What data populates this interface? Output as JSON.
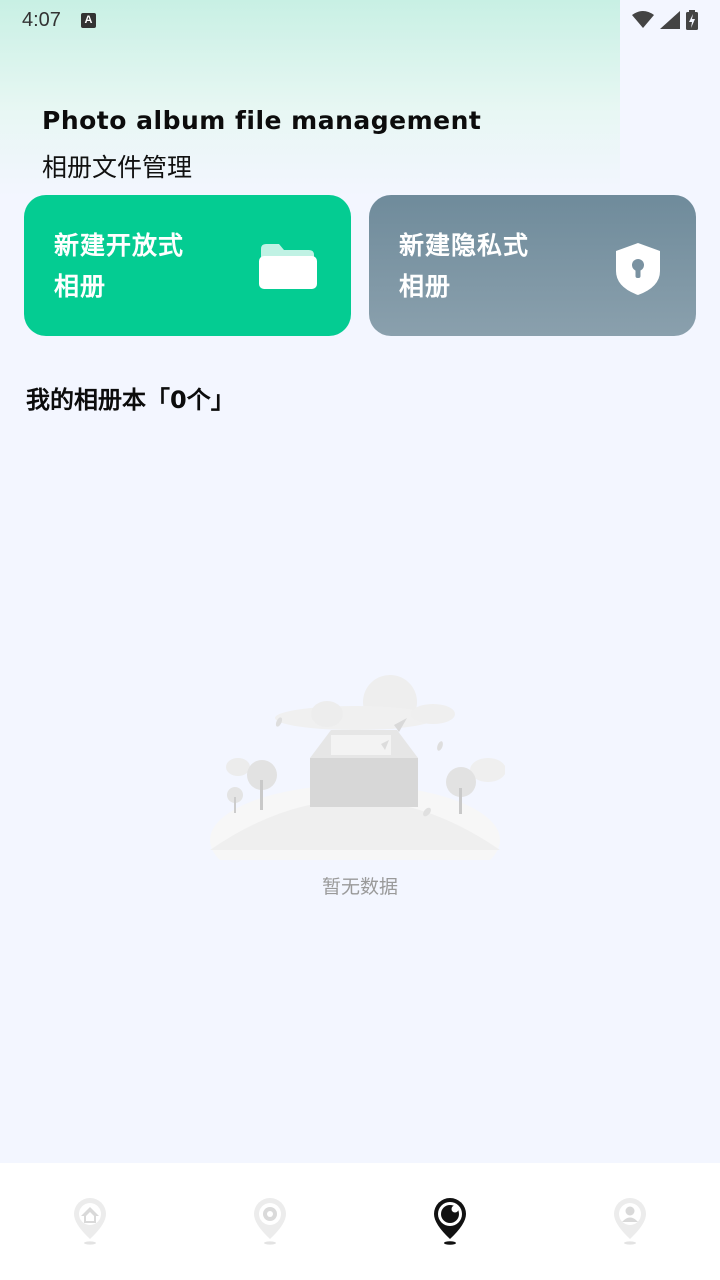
{
  "status_bar": {
    "time": "4:07",
    "notification_icon": "A",
    "icons": [
      "wifi-icon",
      "signal-icon",
      "battery-charging-icon"
    ]
  },
  "header": {
    "title_en": "Photo album file management",
    "title_cn": "相册文件管理"
  },
  "actions": {
    "open_album": {
      "label": "新建开放式\n相册",
      "icon": "folder-icon",
      "color": "#04cc92"
    },
    "private_album": {
      "label": "新建隐私式\n相册",
      "icon": "shield-lock-icon",
      "color": "#7a92a1"
    }
  },
  "albums": {
    "section_title": "我的相册本「0个」",
    "empty_text": "暂无数据"
  },
  "bottom_nav": {
    "items": [
      {
        "icon": "home-icon",
        "active": false
      },
      {
        "icon": "location-icon",
        "active": false
      },
      {
        "icon": "camera-lens-icon",
        "active": true
      },
      {
        "icon": "profile-icon",
        "active": false
      }
    ]
  }
}
